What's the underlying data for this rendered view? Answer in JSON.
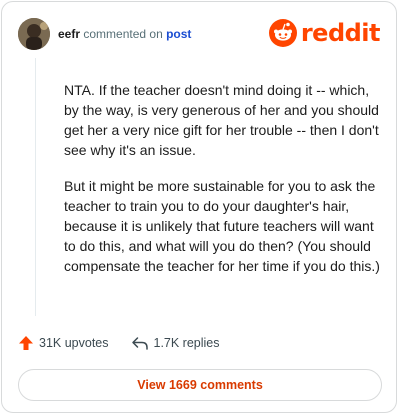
{
  "header": {
    "username": "eefr",
    "action": "commented on",
    "post_link": "post",
    "avatar_icon": "user-avatar",
    "brand_name": "reddit",
    "brand_color": "#ff4500"
  },
  "comment": {
    "paragraphs": [
      "NTA. If the teacher doesn't mind doing it -- which, by the way, is very generous of her and you should get her a very nice gift for her trouble -- then I don't see why it's an issue.",
      "But it might be more sustainable for you to ask the teacher to train you to do your daughter's hair, because it is unlikely that future teachers will want to do this, and what will you do then? (You should compensate the teacher for her time if you do this.)"
    ]
  },
  "footer": {
    "upvotes": "31K upvotes",
    "upvote_icon": "upvote-arrow-icon",
    "replies": "1.7K replies",
    "reply_icon": "reply-arrow-icon"
  },
  "actions": {
    "view_comments": "View 1669 comments"
  },
  "colors": {
    "accent": "#ff4500",
    "link": "#1a4dd2",
    "cta_text": "#d93a00"
  }
}
